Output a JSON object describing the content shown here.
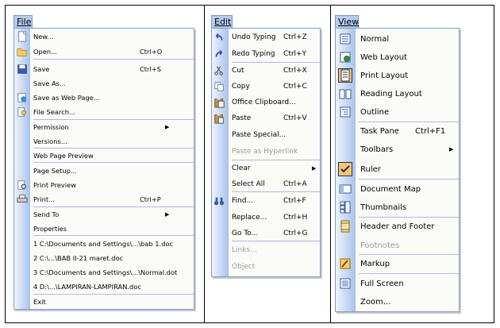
{
  "file_menu": {
    "title": "File",
    "items": [
      {
        "label": "New...",
        "shortcut": "",
        "icon": "new-document-icon"
      },
      {
        "label": "Open...",
        "shortcut": "Ctrl+O",
        "icon": "open-folder-icon"
      },
      {
        "label": "Save",
        "shortcut": "Ctrl+S",
        "icon": "save-disk-icon"
      },
      {
        "label": "Save As...",
        "shortcut": ""
      },
      {
        "label": "Save as Web Page...",
        "shortcut": "",
        "icon": "web-page-icon"
      },
      {
        "label": "File Search...",
        "shortcut": "",
        "icon": "file-search-icon"
      },
      {
        "label": "Permission",
        "shortcut": "",
        "submenu": true
      },
      {
        "label": "Versions...",
        "shortcut": ""
      },
      {
        "label": "Web Page Preview",
        "shortcut": ""
      },
      {
        "label": "Page Setup...",
        "shortcut": ""
      },
      {
        "label": "Print Preview",
        "shortcut": "",
        "icon": "print-preview-icon"
      },
      {
        "label": "Print...",
        "shortcut": "Ctrl+P",
        "icon": "printer-icon"
      },
      {
        "label": "Send To",
        "shortcut": "",
        "submenu": true
      },
      {
        "label": "Properties",
        "shortcut": ""
      },
      {
        "label": "1 C:\\Documents and Settings\\...\\bab 1.doc",
        "shortcut": ""
      },
      {
        "label": "2 C:\\...\\BAB II-21 maret.doc",
        "shortcut": ""
      },
      {
        "label": "3 C:\\Documents and Settings\\...\\Normal.dot",
        "shortcut": ""
      },
      {
        "label": "4 D:\\...\\LAMPIRAN-LAMPIRAN.doc",
        "shortcut": ""
      },
      {
        "label": "Exit",
        "shortcut": ""
      }
    ]
  },
  "edit_menu": {
    "title": "Edit",
    "items": [
      {
        "label": "Undo Typing",
        "shortcut": "Ctrl+Z",
        "icon": "undo-icon"
      },
      {
        "label": "Redo Typing",
        "shortcut": "Ctrl+Y",
        "icon": "redo-icon"
      },
      {
        "label": "Cut",
        "shortcut": "Ctrl+X",
        "icon": "scissors-icon"
      },
      {
        "label": "Copy",
        "shortcut": "Ctrl+C",
        "icon": "copy-icon"
      },
      {
        "label": "Office Clipboard...",
        "shortcut": "",
        "icon": "clipboard-icon"
      },
      {
        "label": "Paste",
        "shortcut": "Ctrl+V",
        "icon": "paste-icon"
      },
      {
        "label": "Paste Special...",
        "shortcut": ""
      },
      {
        "label": "Paste as Hyperlink",
        "shortcut": "",
        "disabled": true
      },
      {
        "label": "Clear",
        "shortcut": "",
        "submenu": true
      },
      {
        "label": "Select All",
        "shortcut": "Ctrl+A"
      },
      {
        "label": "Find...",
        "shortcut": "Ctrl+F",
        "icon": "binoculars-icon"
      },
      {
        "label": "Replace...",
        "shortcut": "Ctrl+H"
      },
      {
        "label": "Go To...",
        "shortcut": "Ctrl+G"
      },
      {
        "label": "Links...",
        "shortcut": "",
        "disabled": true
      },
      {
        "label": "Object",
        "shortcut": "",
        "disabled": true
      }
    ]
  },
  "view_menu": {
    "title": "View",
    "items": [
      {
        "label": "Normal",
        "shortcut": "",
        "icon": "normal-view-icon"
      },
      {
        "label": "Web Layout",
        "shortcut": "",
        "icon": "web-layout-icon"
      },
      {
        "label": "Print Layout",
        "shortcut": "",
        "icon": "print-layout-icon",
        "selected": true
      },
      {
        "label": "Reading Layout",
        "shortcut": "",
        "icon": "reading-layout-icon"
      },
      {
        "label": "Outline",
        "shortcut": "",
        "icon": "outline-view-icon"
      },
      {
        "label": "Task Pane",
        "shortcut": "Ctrl+F1"
      },
      {
        "label": "Toolbars",
        "shortcut": "",
        "submenu": true
      },
      {
        "label": "Ruler",
        "shortcut": "",
        "icon": "checkmark-icon",
        "checked": true
      },
      {
        "label": "Document Map",
        "shortcut": "",
        "icon": "document-map-icon"
      },
      {
        "label": "Thumbnails",
        "shortcut": "",
        "icon": "thumbnails-icon"
      },
      {
        "label": "Header and Footer",
        "shortcut": "",
        "icon": "header-footer-icon"
      },
      {
        "label": "Footnotes",
        "shortcut": "",
        "disabled": true
      },
      {
        "label": "Markup",
        "shortcut": "",
        "icon": "markup-icon"
      },
      {
        "label": "Full Screen",
        "shortcut": "",
        "icon": "full-screen-icon"
      },
      {
        "label": "Zoom...",
        "shortcut": ""
      }
    ]
  },
  "colors": {
    "menu_title_highlight": "#b6ccf0",
    "menu_border": "#7f9ccc",
    "icon_strip_end": "#a9c2ea",
    "checked_bg": "#f9c46b"
  }
}
